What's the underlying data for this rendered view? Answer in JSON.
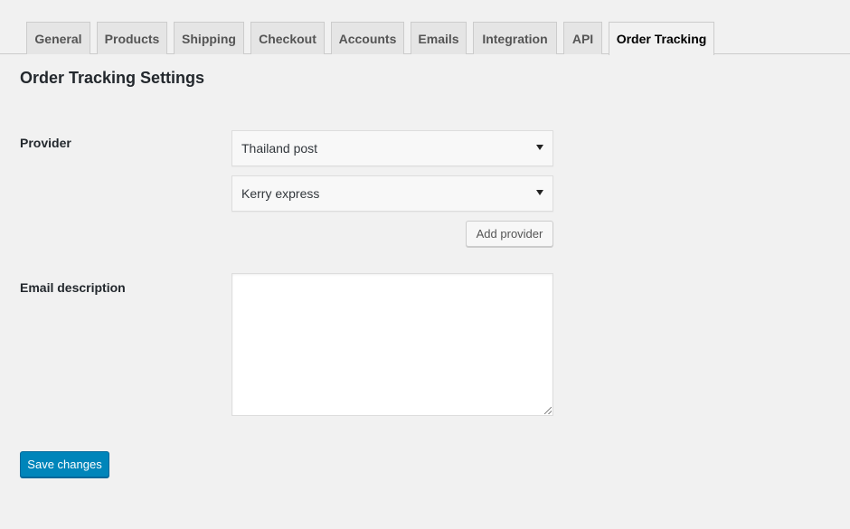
{
  "tabs": [
    {
      "label": "General",
      "active": false
    },
    {
      "label": "Products",
      "active": false
    },
    {
      "label": "Shipping",
      "active": false
    },
    {
      "label": "Checkout",
      "active": false
    },
    {
      "label": "Accounts",
      "active": false
    },
    {
      "label": "Emails",
      "active": false
    },
    {
      "label": "Integration",
      "active": false
    },
    {
      "label": "API",
      "active": false
    },
    {
      "label": "Order Tracking",
      "active": true
    }
  ],
  "page": {
    "title": "Order Tracking Settings"
  },
  "provider": {
    "label": "Provider",
    "selects": [
      {
        "value": "Thailand post"
      },
      {
        "value": "Kerry express"
      }
    ],
    "add_button": "Add provider"
  },
  "email_description": {
    "label": "Email description",
    "value": ""
  },
  "save_button": "Save changes",
  "colors": {
    "background": "#f1f1f1",
    "primary_button": "#0085ba",
    "tab_inactive": "#e5e5e5"
  }
}
